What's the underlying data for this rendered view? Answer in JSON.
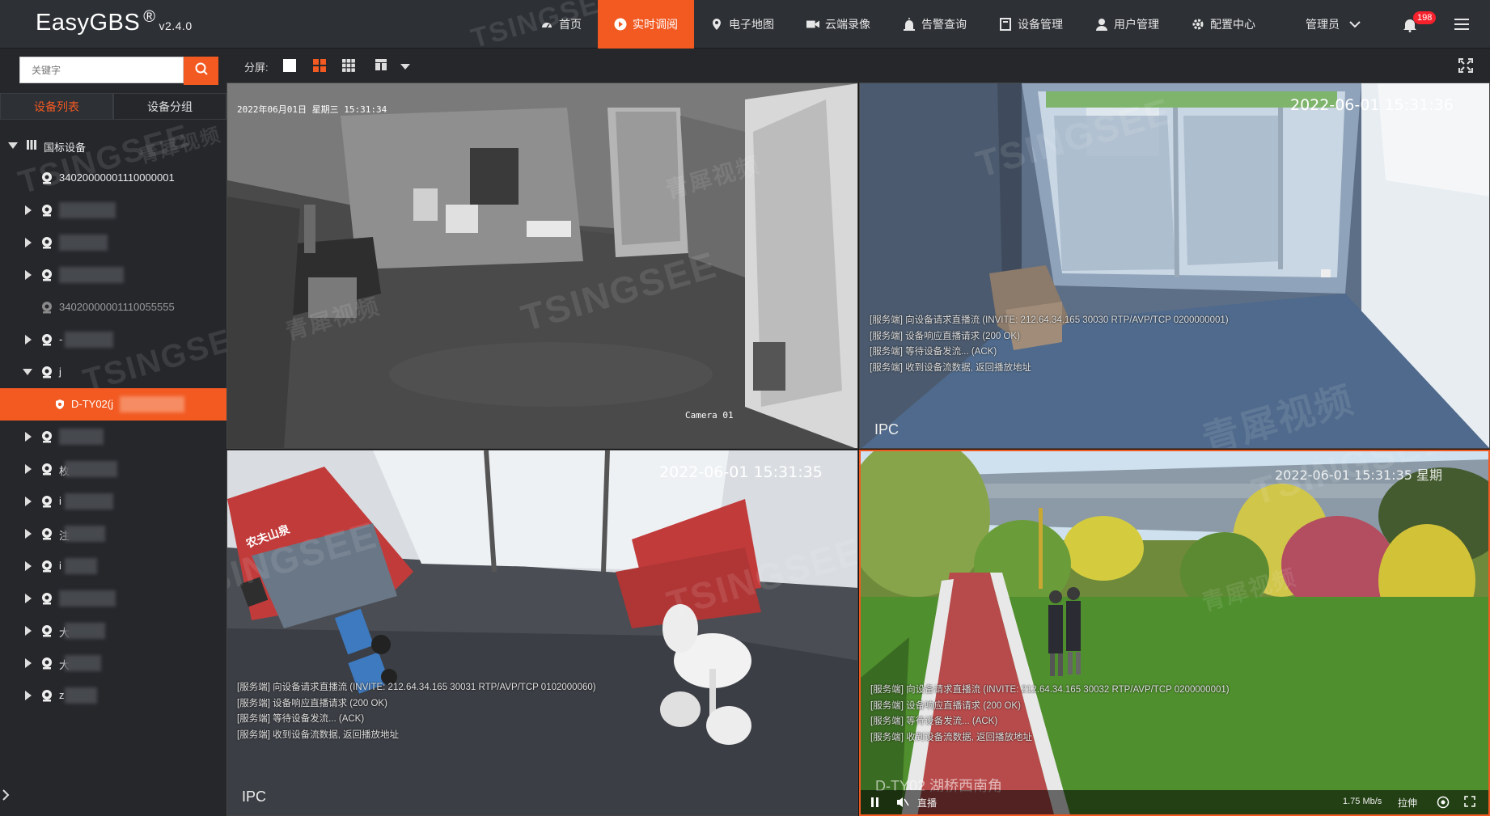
{
  "app": {
    "name": "EasyGBS",
    "reg": "®",
    "version": "v2.4.0"
  },
  "nav": [
    {
      "label": "首页",
      "icon": "dashboard-icon"
    },
    {
      "label": "实时调阅",
      "icon": "play-circle-icon",
      "active": true
    },
    {
      "label": "电子地图",
      "icon": "map-pin-icon"
    },
    {
      "label": "云端录像",
      "icon": "video-camera-icon"
    },
    {
      "label": "告警查询",
      "icon": "alarm-icon"
    },
    {
      "label": "设备管理",
      "icon": "device-icon"
    },
    {
      "label": "用户管理",
      "icon": "user-icon"
    },
    {
      "label": "配置中心",
      "icon": "gear-icon"
    }
  ],
  "user": {
    "name": "管理员",
    "notifications": "198"
  },
  "sidebar": {
    "search_placeholder": "关键字",
    "tabs": [
      "设备列表",
      "设备分组"
    ],
    "root_label": "国标设备",
    "items": [
      {
        "label": "34020000001110000001",
        "expanded": false,
        "has_children": false
      },
      {
        "label": "",
        "has_children": true
      },
      {
        "label": "",
        "has_children": true
      },
      {
        "label": "",
        "has_children": true
      },
      {
        "label": "34020000001110055555",
        "has_children": false,
        "offline": true
      },
      {
        "label": "-",
        "has_children": true
      },
      {
        "label": "j",
        "has_children": true,
        "expanded": true
      },
      {
        "label": "D-TY02(j",
        "selected": true,
        "child": true
      },
      {
        "label": "",
        "has_children": true
      },
      {
        "label": "枚",
        "has_children": true
      },
      {
        "label": "i",
        "has_children": true
      },
      {
        "label": "注",
        "has_children": true
      },
      {
        "label": "i",
        "has_children": true
      },
      {
        "label": "",
        "has_children": true
      },
      {
        "label": "大",
        "has_children": true
      },
      {
        "label": "大",
        "has_children": true
      },
      {
        "label": "z",
        "has_children": true
      }
    ]
  },
  "toolbar": {
    "split_label": "分屏:"
  },
  "panes": [
    {
      "timestamp": "2022年06月01日 星期三 15:31:34",
      "camera_label": "Camera 01",
      "logs": [],
      "ipc": ""
    },
    {
      "timestamp": "2022-06-01 15:31:36",
      "logs": [
        "[服务端] 向设备请求直播流 (INVITE: 212.64.34.165 30030 RTP/AVP/TCP 0200000001)",
        "[服务端] 设备响应直播请求 (200 OK)",
        "[服务端] 等待设备发流... (ACK)",
        "[服务端] 收到设备流数据, 返回播放地址"
      ],
      "ipc": "IPC"
    },
    {
      "timestamp": "2022-06-01 15:31:35",
      "logs": [
        "[服务端] 向设备请求直播流 (INVITE: 212.64.34.165 30031 RTP/AVP/TCP 0102000060)",
        "[服务端] 设备响应直播请求 (200 OK)",
        "[服务端] 等待设备发流... (ACK)",
        "[服务端] 收到设备流数据, 返回播放地址"
      ],
      "ipc": "IPC",
      "sign_text": "农夫山泉"
    },
    {
      "timestamp": "2022-06-01 15:31:35 星期",
      "logs": [
        "[服务端] 向设备请求直播流 (INVITE: 212.64.34.165 30032 RTP/AVP/TCP 0200000001)",
        "[服务端] 设备响应直播请求 (200 OK)",
        "[服务端] 等待设备发流... (ACK)",
        "[服务端] 收到设备流数据, 返回播放地址"
      ],
      "overlay_name": "D-TY02 湖桥西南角",
      "player": {
        "live_label": "直播",
        "bitrate": "1.75 Mb/s",
        "stretch_label": "拉伸"
      }
    }
  ],
  "watermark": {
    "brand": "TSINGSEE",
    "cn": "青犀视频"
  }
}
